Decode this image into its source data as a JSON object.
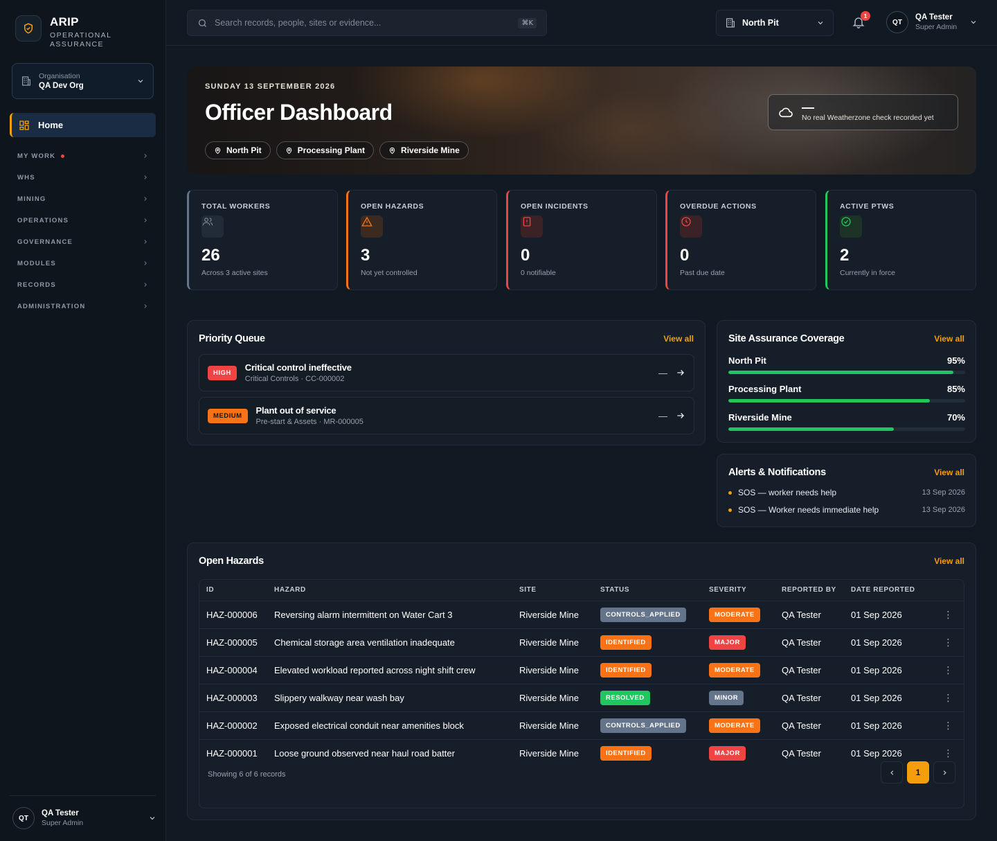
{
  "brand": {
    "name": "ARIP",
    "subtitle_line1": "OPERATIONAL",
    "subtitle_line2": "ASSURANCE"
  },
  "org": {
    "label": "Organisation",
    "value": "QA Dev Org"
  },
  "nav": {
    "home": "Home",
    "sections": [
      "MY WORK",
      "WHS",
      "MINING",
      "OPERATIONS",
      "GOVERNANCE",
      "MODULES",
      "RECORDS",
      "ADMINISTRATION"
    ]
  },
  "user": {
    "initials": "QT",
    "name": "QA Tester",
    "role": "Super Admin"
  },
  "search": {
    "placeholder": "Search records, people, sites or evidence...",
    "shortcut": "⌘K"
  },
  "site_selector": {
    "value": "North Pit"
  },
  "notifications": {
    "count": "1"
  },
  "hero": {
    "date": "SUNDAY 13 SEPTEMBER 2026",
    "title": "Officer Dashboard",
    "sites": [
      "North Pit",
      "Processing Plant",
      "Riverside Mine"
    ],
    "weather": {
      "value": "—",
      "text": "No real Weatherzone check recorded yet"
    }
  },
  "stats": [
    {
      "label": "TOTAL WORKERS",
      "value": "26",
      "sub": "Across 3 active sites",
      "color": "#64748b",
      "icon": "users-icon"
    },
    {
      "label": "OPEN HAZARDS",
      "value": "3",
      "sub": "Not yet controlled",
      "color": "#f97316",
      "icon": "warning-icon"
    },
    {
      "label": "OPEN INCIDENTS",
      "value": "0",
      "sub": "0 notifiable",
      "color": "#ef4444",
      "icon": "incident-icon"
    },
    {
      "label": "OVERDUE ACTIONS",
      "value": "0",
      "sub": "Past due date",
      "color": "#ef4444",
      "icon": "clock-icon"
    },
    {
      "label": "ACTIVE PTWS",
      "value": "2",
      "sub": "Currently in force",
      "color": "#22c55e",
      "icon": "check-circle-icon"
    }
  ],
  "priority_queue": {
    "title": "Priority Queue",
    "view_all": "View all",
    "items": [
      {
        "badge": "HIGH",
        "title": "Critical control ineffective",
        "sub": "Critical Controls · CC-000002",
        "dash": "—"
      },
      {
        "badge": "MEDIUM",
        "title": "Plant out of service",
        "sub": "Pre-start & Assets · MR-000005",
        "dash": "—"
      }
    ]
  },
  "coverage": {
    "title": "Site Assurance Coverage",
    "view_all": "View all",
    "sites": [
      {
        "name": "North Pit",
        "label": "95%",
        "value": 95
      },
      {
        "name": "Processing Plant",
        "label": "85%",
        "value": 85
      },
      {
        "name": "Riverside Mine",
        "label": "70%",
        "value": 70
      }
    ]
  },
  "alerts": {
    "title": "Alerts & Notifications",
    "view_all": "View all",
    "items": [
      {
        "text": "SOS — worker needs help",
        "date": "13 Sep 2026"
      },
      {
        "text": "SOS — Worker needs immediate help",
        "date": "13 Sep 2026"
      }
    ]
  },
  "hazards": {
    "title": "Open Hazards",
    "view_all": "View all",
    "columns": [
      "ID",
      "HAZARD",
      "SITE",
      "STATUS",
      "SEVERITY",
      "REPORTED BY",
      "DATE REPORTED"
    ],
    "rows": [
      {
        "id": "HAZ-000006",
        "hazard": "Reversing alarm intermittent on Water Cart 3",
        "site": "Riverside Mine",
        "status": "CONTROLS_APPLIED",
        "severity": "MODERATE",
        "reported_by": "QA Tester",
        "date": "01 Sep 2026"
      },
      {
        "id": "HAZ-000005",
        "hazard": "Chemical storage area ventilation inadequate",
        "site": "Riverside Mine",
        "status": "IDENTIFIED",
        "severity": "MAJOR",
        "reported_by": "QA Tester",
        "date": "01 Sep 2026"
      },
      {
        "id": "HAZ-000004",
        "hazard": "Elevated workload reported across night shift crew",
        "site": "Riverside Mine",
        "status": "IDENTIFIED",
        "severity": "MODERATE",
        "reported_by": "QA Tester",
        "date": "01 Sep 2026"
      },
      {
        "id": "HAZ-000003",
        "hazard": "Slippery walkway near wash bay",
        "site": "Riverside Mine",
        "status": "RESOLVED",
        "severity": "MINOR",
        "reported_by": "QA Tester",
        "date": "01 Sep 2026"
      },
      {
        "id": "HAZ-000002",
        "hazard": "Exposed electrical conduit near amenities block",
        "site": "Riverside Mine",
        "status": "CONTROLS_APPLIED",
        "severity": "MODERATE",
        "reported_by": "QA Tester",
        "date": "01 Sep 2026"
      },
      {
        "id": "HAZ-000001",
        "hazard": "Loose ground observed near haul road batter",
        "site": "Riverside Mine",
        "status": "IDENTIFIED",
        "severity": "MAJOR",
        "reported_by": "QA Tester",
        "date": "01 Sep 2026"
      }
    ],
    "footer": "Showing 6 of 6 records",
    "page": "1"
  }
}
